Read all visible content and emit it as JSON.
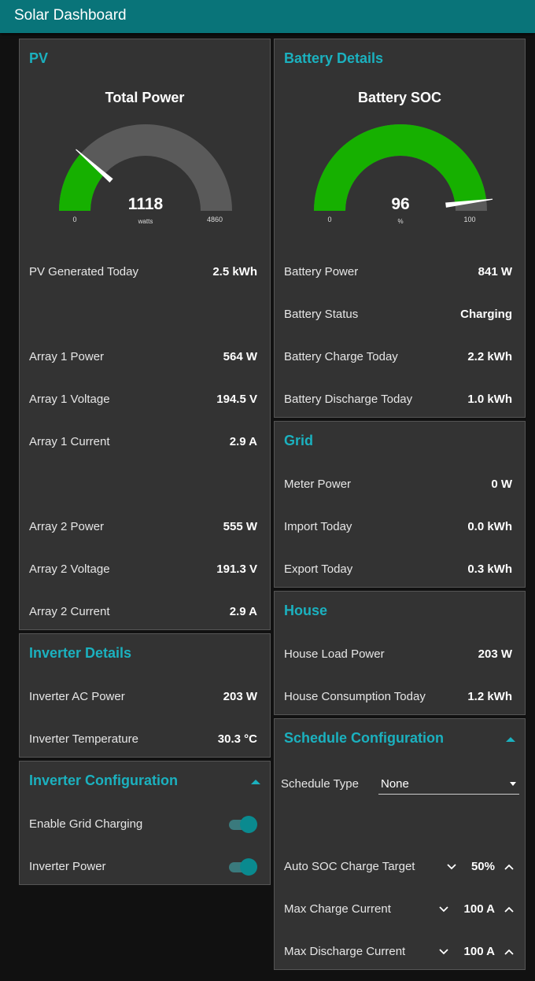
{
  "app": {
    "title": "Solar Dashboard"
  },
  "pv": {
    "title": "PV",
    "gauge": {
      "title": "Total Power",
      "value": "1118",
      "unit": "watts",
      "min": "0",
      "max": "4860",
      "fraction": 0.23
    },
    "rows": [
      {
        "label": "PV Generated Today",
        "value": "2.5 kWh"
      },
      {
        "label": "Array 1 Power",
        "value": "564 W"
      },
      {
        "label": "Array 1 Voltage",
        "value": "194.5 V"
      },
      {
        "label": "Array 1 Current",
        "value": "2.9 A"
      },
      {
        "label": "Array 2 Power",
        "value": "555 W"
      },
      {
        "label": "Array 2 Voltage",
        "value": "191.3 V"
      },
      {
        "label": "Array 2 Current",
        "value": "2.9 A"
      }
    ]
  },
  "battery": {
    "title": "Battery Details",
    "gauge": {
      "title": "Battery SOC",
      "value": "96",
      "unit": "%",
      "min": "0",
      "max": "100",
      "fraction": 0.96
    },
    "rows": [
      {
        "label": "Battery Power",
        "value": "841 W"
      },
      {
        "label": "Battery Status",
        "value": "Charging"
      },
      {
        "label": "Battery Charge Today",
        "value": "2.2 kWh"
      },
      {
        "label": "Battery Discharge Today",
        "value": "1.0 kWh"
      }
    ]
  },
  "grid": {
    "title": "Grid",
    "rows": [
      {
        "label": "Meter Power",
        "value": "0 W"
      },
      {
        "label": "Import Today",
        "value": "0.0 kWh"
      },
      {
        "label": "Export Today",
        "value": "0.3 kWh"
      }
    ]
  },
  "house": {
    "title": "House",
    "rows": [
      {
        "label": "House Load Power",
        "value": "203 W"
      },
      {
        "label": "House Consumption Today",
        "value": "1.2 kWh"
      }
    ]
  },
  "inverter": {
    "title": "Inverter Details",
    "rows": [
      {
        "label": "Inverter AC Power",
        "value": "203 W"
      },
      {
        "label": "Inverter Temperature",
        "value": "30.3 °C"
      }
    ]
  },
  "inverter_config": {
    "title": "Inverter Configuration",
    "toggles": [
      {
        "label": "Enable Grid Charging",
        "on": true
      },
      {
        "label": "Inverter Power",
        "on": true
      }
    ]
  },
  "schedule": {
    "title": "Schedule Configuration",
    "type_label": "Schedule Type",
    "type_value": "None",
    "steppers": [
      {
        "label": "Auto SOC Charge Target",
        "value": "50%"
      },
      {
        "label": "Max Charge Current",
        "value": "100 A"
      },
      {
        "label": "Max Discharge Current",
        "value": "100 A"
      }
    ]
  },
  "colors": {
    "accent": "#1bb1bf",
    "header": "#097479",
    "gauge_fill": "#16b000",
    "gauge_track": "#5a5a5a",
    "card": "#333333"
  }
}
